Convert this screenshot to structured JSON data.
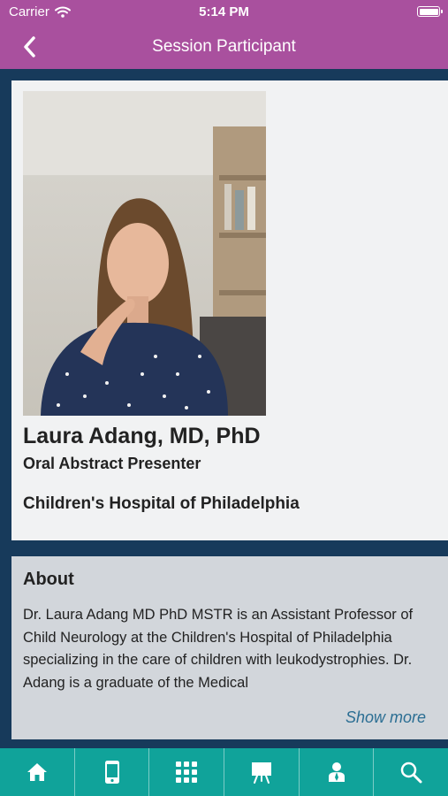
{
  "status_bar": {
    "carrier": "Carrier",
    "time": "5:14 PM"
  },
  "nav": {
    "title": "Session Participant",
    "back_icon": "chevron-left-icon"
  },
  "participant": {
    "name": "Laura Adang, MD, PhD",
    "role": "Oral Abstract Presenter",
    "organization": "Children's Hospital of Philadelphia"
  },
  "about": {
    "heading": "About",
    "text": "Dr. Laura Adang MD PhD MSTR is an Assistant Professor of Child Neurology at the Children's Hospital of Philadelphia specializing in the care of children with leukodystrophies. Dr. Adang is a graduate of the Medical",
    "show_more": "Show more"
  },
  "tabs": [
    {
      "icon": "home-icon"
    },
    {
      "icon": "mobile-device-icon"
    },
    {
      "icon": "grid-icon"
    },
    {
      "icon": "presentation-easel-icon"
    },
    {
      "icon": "speaker-icon"
    },
    {
      "icon": "search-icon"
    }
  ],
  "colors": {
    "header": "#a9509e",
    "tabbar": "#10a39a",
    "background": "#173a5b",
    "link": "#2b6e93"
  }
}
